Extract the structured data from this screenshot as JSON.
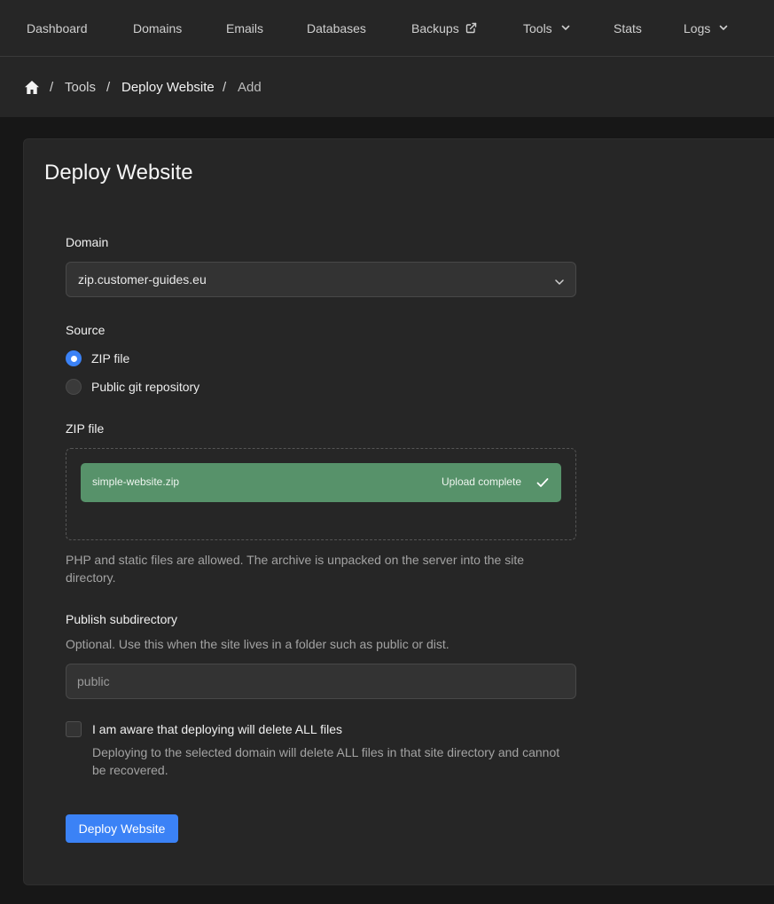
{
  "nav": {
    "items": [
      {
        "label": "Dashboard"
      },
      {
        "label": "Domains"
      },
      {
        "label": "Emails"
      },
      {
        "label": "Databases"
      },
      {
        "label": "Backups",
        "icon": "external-link-icon"
      },
      {
        "label": "Tools",
        "icon": "chevron-down-icon"
      },
      {
        "label": "Stats"
      },
      {
        "label": "Logs",
        "icon": "chevron-down-icon"
      }
    ]
  },
  "breadcrumb": {
    "home_icon": "home-icon",
    "separator": "/",
    "items": [
      "Tools",
      "Deploy Website",
      "Add"
    ]
  },
  "page": {
    "title": "Deploy Website"
  },
  "form": {
    "domain": {
      "label": "Domain",
      "value": "zip.customer-guides.eu"
    },
    "source": {
      "label": "Source",
      "options": [
        {
          "label": "ZIP file",
          "selected": true
        },
        {
          "label": "Public git repository",
          "selected": false
        }
      ]
    },
    "zip": {
      "label": "ZIP file",
      "file_name": "simple-website.zip",
      "status": "Upload complete",
      "help": "PHP and static files are allowed. The archive is unpacked on the server into the site directory."
    },
    "subdir": {
      "label": "Publish subdirectory",
      "help": "Optional. Use this when the site lives in a folder such as public or dist.",
      "placeholder": "public",
      "value": ""
    },
    "confirm": {
      "label": "I am aware that deploying will delete ALL files",
      "help": "Deploying to the selected domain will delete ALL files in that site directory and cannot be recovered.",
      "checked": false
    },
    "submit_label": "Deploy Website"
  },
  "colors": {
    "accent": "#3b82f6",
    "success": "#57926a",
    "background": "#171717",
    "surface": "#262626"
  }
}
